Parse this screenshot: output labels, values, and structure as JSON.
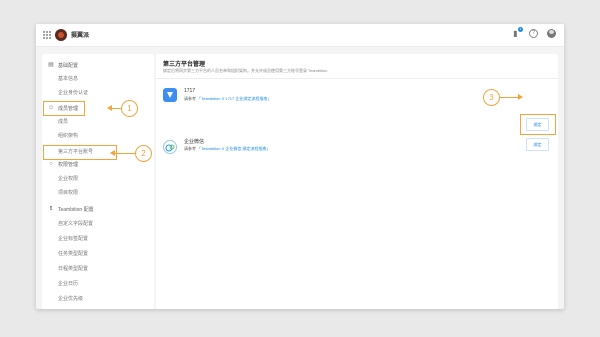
{
  "topbar": {
    "org_name": "摄翼派",
    "notification_count": "3"
  },
  "sidebar": {
    "sections": [
      {
        "label": "基础配置",
        "icon": "building-icon",
        "items": [
          "基本信息",
          "企业身份认证"
        ]
      },
      {
        "label": "成员管理",
        "icon": "user-icon",
        "items": [
          "成员",
          "组织架构",
          "第三方平台账号"
        ]
      },
      {
        "label": "权限管理",
        "icon": "lock-icon",
        "items": [
          "企业权限",
          "项目权限"
        ]
      },
      {
        "label": "Teambition 配置",
        "icon": "teambition-icon",
        "items": [
          "自定义字段配置",
          "企业标签配置",
          "任务类型配置",
          "日程类型配置",
          "企业日历",
          "企业优先级"
        ]
      }
    ]
  },
  "main": {
    "title": "第三方平台管理",
    "description": "绑定后将同步第三方平台的人员名单和组织架构，并允许成员使用第三方账号登录 Teambition",
    "platforms": [
      {
        "name": "1717",
        "prefix": "请参考",
        "link": "「Teambition X 1717 企业绑定流程指南」",
        "button": "绑定",
        "icon": "1717-icon",
        "color": "#3d8ef0"
      },
      {
        "name": "企业微信",
        "prefix": "请参考",
        "link": "「Teambition X 企业微信 绑定流程指南」",
        "button": "绑定",
        "icon": "wechat-work-icon",
        "color": "#1e9be8"
      }
    ]
  },
  "callouts": [
    "1",
    "2",
    "3"
  ],
  "colors": {
    "accent": "#f3a43c",
    "link": "#1b88e5"
  }
}
